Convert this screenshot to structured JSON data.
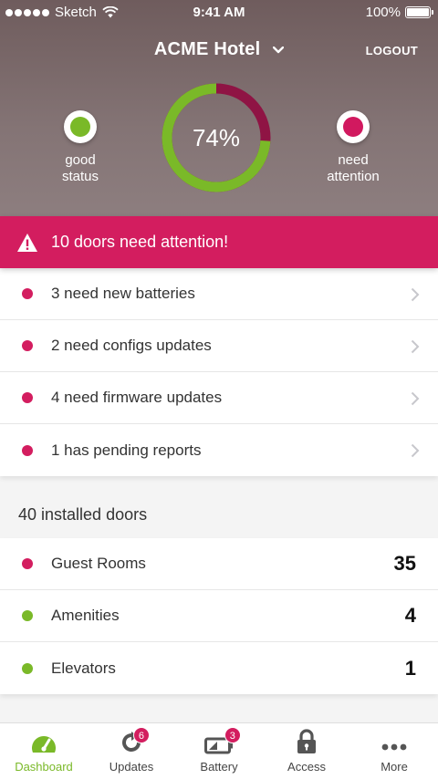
{
  "status_bar": {
    "carrier": "Sketch",
    "time": "9:41 AM",
    "battery": "100%"
  },
  "header": {
    "hotel_name": "ACME Hotel",
    "logout_label": "LOGOUT",
    "good_status_label_1": "good",
    "good_status_label_2": "status",
    "need_attention_label_1": "need",
    "need_attention_label_2": "attention",
    "ring_percent_text": "74%",
    "ring_percent_value": 0.74,
    "colors": {
      "good": "#7ab928",
      "attention": "#d1195f",
      "attention_dark": "#8f1444"
    }
  },
  "alert": {
    "text": "10 doors need attention!",
    "color": "#d31d5f"
  },
  "issues": [
    {
      "label": "3 need new batteries"
    },
    {
      "label": "2 need configs updates"
    },
    {
      "label": "4 need firmware updates"
    },
    {
      "label": "1 has pending reports"
    }
  ],
  "doors": {
    "title": "40 installed doors",
    "items": [
      {
        "label": "Guest Rooms",
        "count": "35",
        "status": "attention"
      },
      {
        "label": "Amenities",
        "count": "4",
        "status": "good"
      },
      {
        "label": "Elevators",
        "count": "1",
        "status": "good"
      }
    ]
  },
  "tabs": [
    {
      "label": "Dashboard",
      "icon": "gauge-icon",
      "active": true
    },
    {
      "label": "Updates",
      "icon": "refresh-icon",
      "badge": "6"
    },
    {
      "label": "Battery",
      "icon": "battery-icon",
      "badge": "3"
    },
    {
      "label": "Access",
      "icon": "lock-icon"
    },
    {
      "label": "More",
      "icon": "more-icon"
    }
  ]
}
